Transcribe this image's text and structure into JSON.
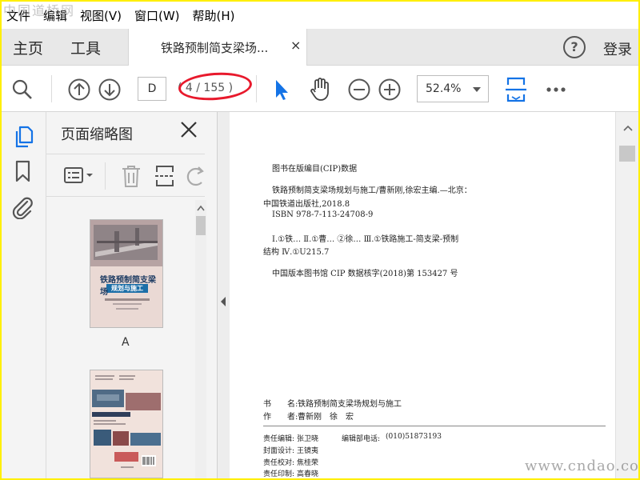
{
  "watermarks": {
    "top_left": "中国道桥网",
    "bottom_right": "www.cndao.com"
  },
  "menu": [
    "文件",
    "编辑",
    "视图(V)",
    "窗口(W)",
    "帮助(H)"
  ],
  "tabs": {
    "home": "主页",
    "tools": "工具",
    "document_title": "铁路预制简支梁场...",
    "close": "×",
    "login": "登录"
  },
  "toolbar": {
    "page_input": "D",
    "page_count": "( 4 / 155 )",
    "zoom": "52.4%"
  },
  "thumbnail_panel": {
    "title": "页面缩略图",
    "thumb1_label": "A",
    "cover_title_1": "铁路预制简支梁场",
    "cover_title_2": "规划与施工"
  },
  "document": {
    "cip_heading": "图书在版编目(CIP)数据",
    "cip_lines": [
      "铁路预制简支梁场规划与施工/曹新刚,徐宏主编.—北京：",
      "中国铁道出版社,2018.8",
      "ISBN 978-7-113-24708-9",
      "Ⅰ.①铁… Ⅱ.①曹… ②徐… Ⅲ.①铁路施工-简支梁-预制",
      "结构 Ⅳ.①U215.7",
      "中国版本图书馆 CIP 数据核字(2018)第 153427 号"
    ],
    "book_name_label": "书　　名:",
    "book_name": "铁路预制简支梁场规划与施工",
    "author_label": "作　　者:",
    "author": "曹新刚　徐　宏",
    "editor_label": "责任编辑:",
    "editor": "张卫晓",
    "phone_label": "编辑部电话:",
    "phone": "(010)51873193",
    "cover_design_label": "封面设计:",
    "cover_design": "王镜夷",
    "proofread_label": "责任校对:",
    "proofread": "焦桂荣",
    "print_label": "责任印制:",
    "print": "高春晓"
  },
  "colors": {
    "accent": "#1473e6",
    "annotation": "#e8192c",
    "highlight": "#ffef00"
  },
  "icons": [
    "search-icon",
    "arrow-up-icon",
    "arrow-down-icon",
    "cursor-icon",
    "hand-icon",
    "zoom-out-icon",
    "zoom-in-icon",
    "fit-page-icon",
    "more-icon",
    "help-icon",
    "pages-icon",
    "bookmark-icon",
    "attachment-icon",
    "options-icon",
    "trash-icon",
    "insert-icon",
    "rotate-icon",
    "close-icon"
  ]
}
